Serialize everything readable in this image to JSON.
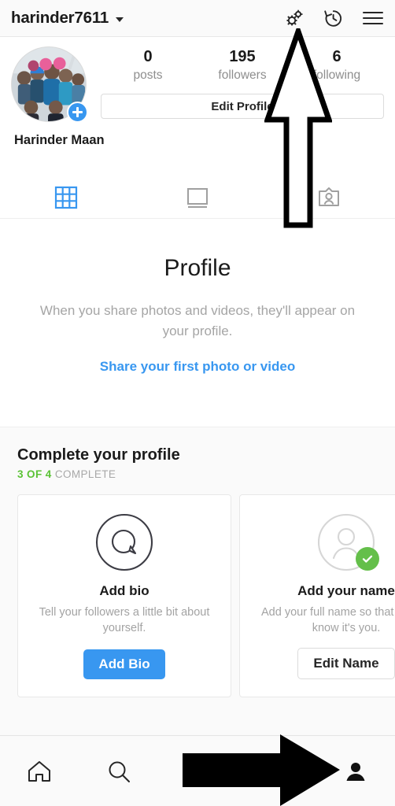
{
  "header": {
    "username": "harinder7611",
    "dropdown_icon": "chevron-down-icon",
    "actions": [
      {
        "name": "settings-gears-icon",
        "label": "Settings"
      },
      {
        "name": "archive-history-icon",
        "label": "Archive"
      },
      {
        "name": "hamburger-menu-icon",
        "label": "Menu"
      }
    ]
  },
  "profile": {
    "avatar_alt": "Group photo of friends",
    "add_story_badge": "+",
    "full_name": "Harinder Maan",
    "edit_profile_label": "Edit Profile",
    "stats": [
      {
        "value": "0",
        "label": "posts"
      },
      {
        "value": "195",
        "label": "followers"
      },
      {
        "value": "6",
        "label": "following"
      }
    ]
  },
  "tabs": [
    {
      "name": "tab-grid",
      "icon": "grid-icon",
      "active": true
    },
    {
      "name": "tab-list",
      "icon": "list-feed-icon",
      "active": false
    },
    {
      "name": "tab-tagged",
      "icon": "tagged-person-icon",
      "active": false
    }
  ],
  "empty_state": {
    "title": "Profile",
    "description": "When you share photos and videos, they'll appear on your profile.",
    "link": "Share your first photo or video"
  },
  "complete_profile": {
    "title": "Complete your profile",
    "progress_done": "3 OF 4",
    "progress_rest": "COMPLETE",
    "cards": [
      {
        "icon": "bio-speech-bubble-icon",
        "title": "Add bio",
        "description": "Tell your followers a little bit about yourself.",
        "button": "Add Bio",
        "button_style": "primary",
        "completed": false
      },
      {
        "icon": "person-circle-icon",
        "title": "Add your name",
        "description": "Add your full name so that friends know it's you.",
        "button": "Edit Name",
        "button_style": "outline",
        "completed": true
      }
    ]
  },
  "bottom_nav": [
    {
      "name": "nav-home",
      "icon": "home-icon",
      "active": false
    },
    {
      "name": "nav-search",
      "icon": "search-icon",
      "active": false
    },
    {
      "name": "nav-reels",
      "icon": "reels-icon",
      "active": false
    },
    {
      "name": "nav-activity",
      "icon": "heart-icon",
      "active": false
    },
    {
      "name": "nav-profile",
      "icon": "person-filled-icon",
      "active": true
    }
  ],
  "annotations": [
    {
      "name": "arrow-pointing-to-settings",
      "direction": "up"
    },
    {
      "name": "arrow-pointing-to-profile-tab",
      "direction": "right"
    }
  ],
  "colors": {
    "accent_blue": "#3897f0",
    "green": "#5bc236",
    "text_dark": "#1b1b1b",
    "text_muted": "#8e8e8e"
  }
}
